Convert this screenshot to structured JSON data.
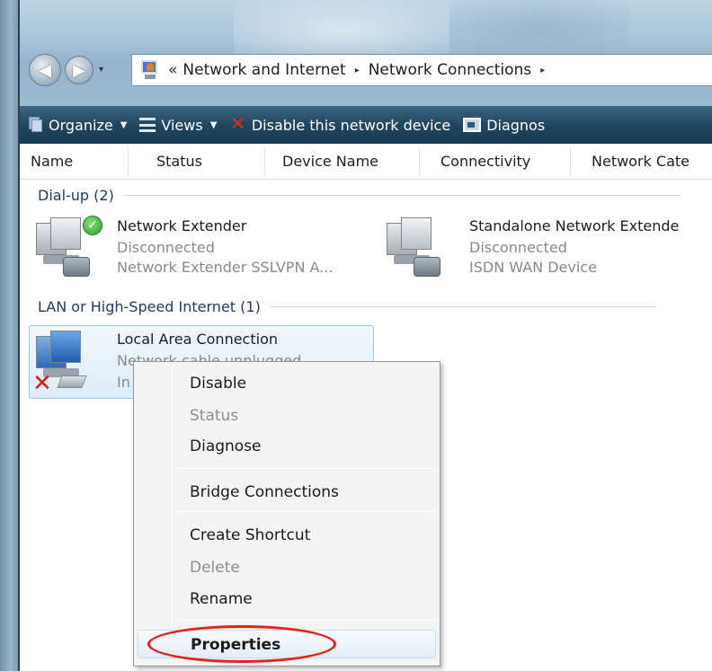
{
  "address_bar": {
    "back_chevron": "«",
    "crumbs": [
      "Network and Internet",
      "Network Connections"
    ],
    "separator": "▸"
  },
  "toolbar": {
    "organize_label": "Organize",
    "views_label": "Views",
    "disable_label": "Disable this network device",
    "diagnose_label": "Diagnos"
  },
  "columns": [
    "Name",
    "Status",
    "Device Name",
    "Connectivity",
    "Network Cate"
  ],
  "groups": {
    "dialup": {
      "header": "Dial-up (2)",
      "items": [
        {
          "name": "Network Extender",
          "status": "Disconnected",
          "device": "Network Extender SSLVPN A..."
        },
        {
          "name": "Standalone Network Extende",
          "status": "Disconnected",
          "device": "ISDN WAN Device"
        }
      ]
    },
    "lan": {
      "header": "LAN or High-Speed Internet (1)",
      "items": [
        {
          "name": "Local Area Connection",
          "status": "Network cable unplugged",
          "device": "In"
        }
      ]
    }
  },
  "context_menu": {
    "items": [
      {
        "label": "Disable",
        "enabled": true,
        "bold": false
      },
      {
        "label": "Status",
        "enabled": false,
        "bold": false
      },
      {
        "label": "Diagnose",
        "enabled": true,
        "bold": false
      },
      {
        "label": "Bridge Connections",
        "enabled": true,
        "bold": false
      },
      {
        "label": "Create Shortcut",
        "enabled": true,
        "bold": false
      },
      {
        "label": "Delete",
        "enabled": false,
        "bold": false
      },
      {
        "label": "Rename",
        "enabled": true,
        "bold": false
      },
      {
        "label": "Properties",
        "enabled": true,
        "bold": true
      }
    ]
  },
  "colors": {
    "toolbar": "#21465f",
    "highlight_ellipse": "#e8211a",
    "disabled_text": "#8d8d8d"
  },
  "icons": {
    "back": "back-arrow-icon",
    "forward": "forward-arrow-icon",
    "address": "network-folder-icon",
    "organize": "organize-icon",
    "views": "views-icon",
    "disable": "red-x-icon",
    "diagnose": "diagnose-icon",
    "connected_check": "green-check-icon",
    "unplugged": "red-x-icon"
  }
}
